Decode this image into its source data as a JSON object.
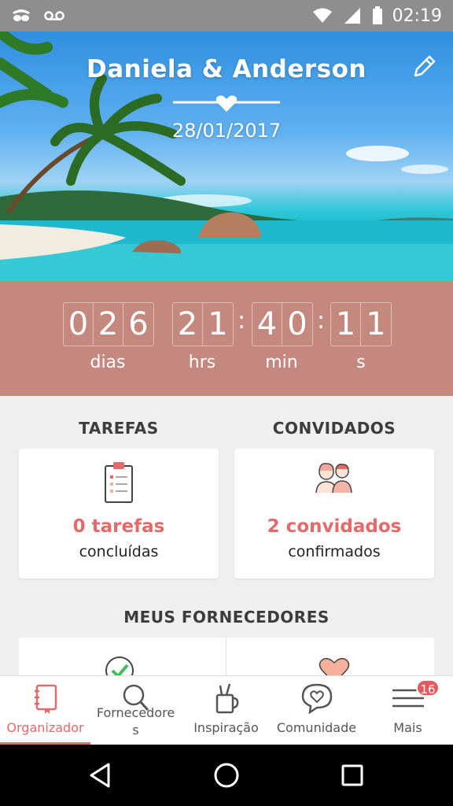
{
  "status_bar": {
    "time": "02:19",
    "icons": [
      "incognito-icon",
      "voicemail-icon",
      "wifi-icon",
      "signal-icon",
      "battery-icon"
    ]
  },
  "hero": {
    "couple_names": "Daniela & Anderson",
    "wedding_date": "28/01/2017"
  },
  "countdown": {
    "days": [
      "0",
      "2",
      "6"
    ],
    "hours": [
      "2",
      "1"
    ],
    "minutes": [
      "4",
      "0"
    ],
    "seconds": [
      "1",
      "1"
    ],
    "labels": {
      "days": "dias",
      "hours": "hrs",
      "minutes": "min",
      "seconds": "s"
    }
  },
  "tasks": {
    "title": "TAREFAS",
    "count": "0 tarefas",
    "sub": "concluídas"
  },
  "guests": {
    "title": "CONVIDADOS",
    "count": "2 convidados",
    "sub": "confirmados"
  },
  "vendors": {
    "title": "MEUS FORNECEDORES"
  },
  "bottom_nav": {
    "items": [
      {
        "label": "Organizador",
        "icon": "notebook-icon"
      },
      {
        "label_line1": "Fornecedore",
        "label_line2": "s",
        "icon": "search-icon"
      },
      {
        "label": "Inspiração",
        "icon": "pencil-cup-icon"
      },
      {
        "label": "Comunidade",
        "icon": "chat-heart-icon"
      },
      {
        "label": "Mais",
        "icon": "menu-icon",
        "badge": "16"
      }
    ]
  },
  "colors": {
    "accent": "#e36a6a",
    "countdown_bg": "#c4887f",
    "status_bar": "#8e8e8e"
  }
}
